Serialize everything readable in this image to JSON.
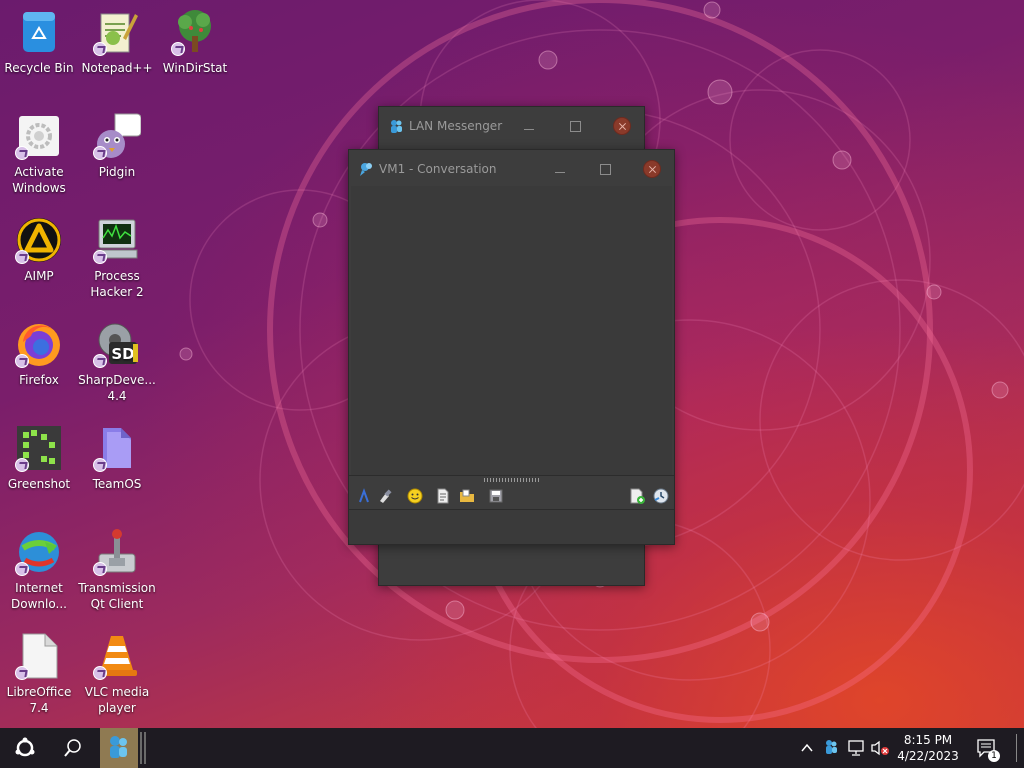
{
  "desktop_icons": [
    {
      "label": "Recycle Bin",
      "icon": "recycle-bin-icon"
    },
    {
      "label": "Notepad++",
      "icon": "notepad-plus-plus-icon"
    },
    {
      "label": "WinDirStat",
      "icon": "windirstat-icon"
    },
    {
      "label": "Activate Windows",
      "icon": "activate-windows-icon"
    },
    {
      "label": "Pidgin",
      "icon": "pidgin-icon"
    },
    {
      "label": "AIMP",
      "icon": "aimp-icon"
    },
    {
      "label": "Process Hacker 2",
      "icon": "process-hacker-icon"
    },
    {
      "label": "Firefox",
      "icon": "firefox-icon"
    },
    {
      "label": "SharpDeve... 4.4",
      "icon": "sharpdevelop-icon"
    },
    {
      "label": "Greenshot",
      "icon": "greenshot-icon"
    },
    {
      "label": "TeamOS",
      "icon": "folder-icon"
    },
    {
      "label": "Internet Downlo...",
      "icon": "internet-download-manager-icon"
    },
    {
      "label": "Transmission Qt Client",
      "icon": "transmission-icon"
    },
    {
      "label": "LibreOffice 7.4",
      "icon": "libreoffice-icon"
    },
    {
      "label": "VLC media player",
      "icon": "vlc-icon"
    }
  ],
  "windows": {
    "lan_messenger": {
      "title": "LAN Messenger"
    },
    "conversation": {
      "title": "VM1 - Conversation"
    }
  },
  "taskbar": {
    "time": "8:15 PM",
    "date": "4/22/2023",
    "notification_count": "1"
  },
  "colors": {
    "window_bg": "#3d3d3d",
    "taskbar_bg": "#1e1b22",
    "close_button": "#8a3a2a"
  }
}
